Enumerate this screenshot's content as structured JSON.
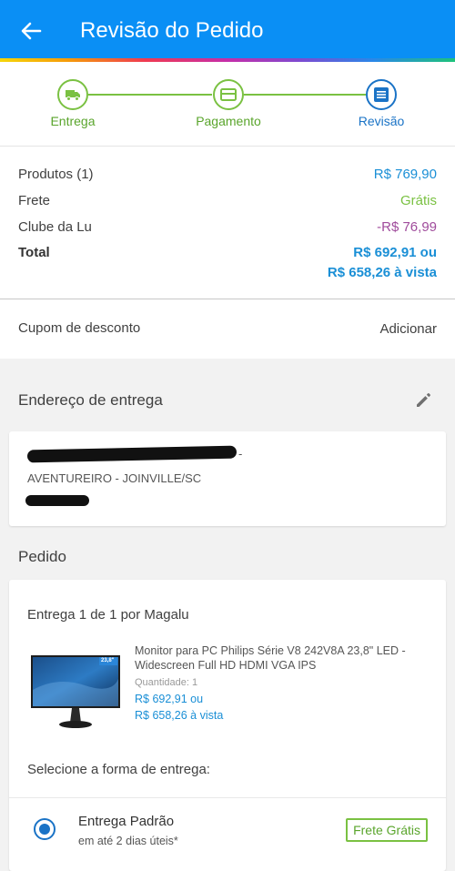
{
  "header": {
    "title": "Revisão do Pedido",
    "back_icon": "arrow-left-icon"
  },
  "steps": [
    {
      "label": "Entrega",
      "icon": "truck-icon",
      "state": "done"
    },
    {
      "label": "Pagamento",
      "icon": "card-icon",
      "state": "done"
    },
    {
      "label": "Revisão",
      "icon": "list-icon",
      "state": "active"
    }
  ],
  "summary": {
    "products_label": "Produtos (1)",
    "products_value": "R$ 769,90",
    "shipping_label": "Frete",
    "shipping_value": "Grátis",
    "club_label": "Clube da Lu",
    "club_value": "-R$ 76,99",
    "total_label": "Total",
    "total_value_1": "R$ 692,91 ou",
    "total_value_2": "R$ 658,26 à vista"
  },
  "coupon": {
    "label": "Cupom de desconto",
    "action": "Adicionar"
  },
  "address": {
    "title": "Endereço de entrega",
    "line1_suffix": "-",
    "line2": "AVENTUREIRO - JOINVILLE/SC"
  },
  "order": {
    "title": "Pedido",
    "delivery_header": "Entrega 1 de 1 por Magalu",
    "product_name_1": "Monitor para PC Philips Série V8 242V8A 23,8\" LED -",
    "product_name_2": "Widescreen Full HD HDMI VGA IPS",
    "quantity_label": "Quantidade:",
    "quantity_value": "1",
    "price_1": "R$ 692,91 ou",
    "price_2": "R$ 658,26 à vista",
    "monitor_size_tag": "23,8\"",
    "select_delivery": "Selecione a forma de entrega:"
  },
  "delivery_option": {
    "name": "Entrega Padrão",
    "time": "em até 2 dias úteis*",
    "badge": "Frete Grátis"
  },
  "colors": {
    "primary_blue": "#0a8ff5",
    "green": "#7ac142",
    "price_blue": "#1a73c6",
    "club_purple": "#a04c9c"
  }
}
